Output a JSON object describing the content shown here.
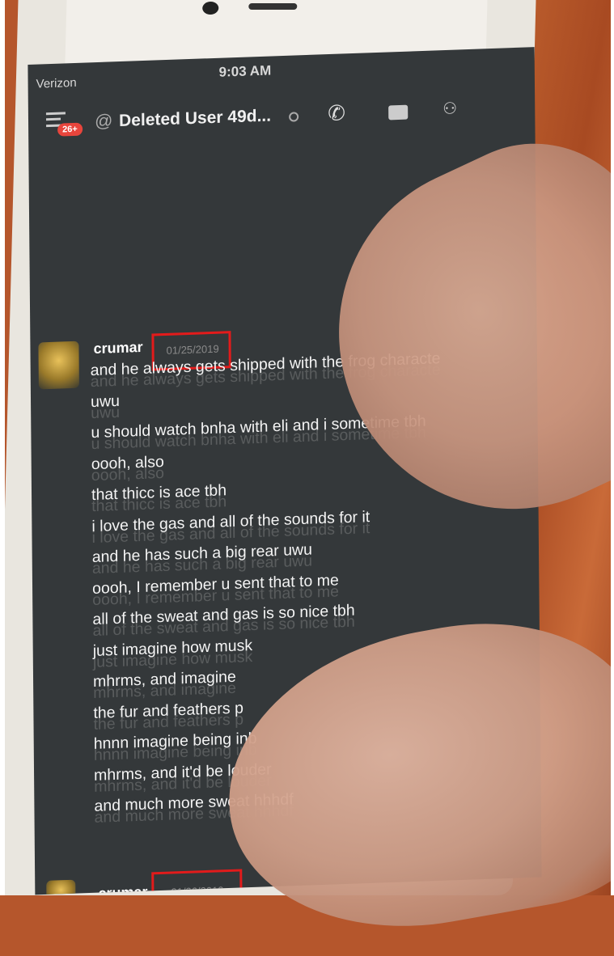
{
  "status_bar": {
    "carrier": "Verizon",
    "time": "9:03 AM"
  },
  "header": {
    "badge": "26+",
    "title": "Deleted User 49d..."
  },
  "message_group_1": {
    "author": "crumar",
    "timestamp": "01/25/2019",
    "lines": [
      "and he always gets shipped with the frog characte",
      "uwu",
      "u should watch bnha with eli and i sometime tbh",
      "oooh, also",
      "that thicc is ace tbh",
      "i love the gas and all of the sounds for it",
      "and he has such a big rear uwu",
      "oooh, I remember u sent that to me",
      "all of the sweat and gas is so nice tbh",
      "just imagine how musk",
      "mhrms, and imagine",
      "the fur and feathers p",
      "hnnn imagine being inb",
      "mhrms, and  it'd be louder",
      "and much more sweat hhhdf"
    ]
  },
  "message_group_2": {
    "author": "crumar",
    "timestamp": "01/26/2019"
  },
  "colors": {
    "screen_bg": "#34383a",
    "highlight_box": "#e21b1b",
    "badge": "#e8453c"
  }
}
